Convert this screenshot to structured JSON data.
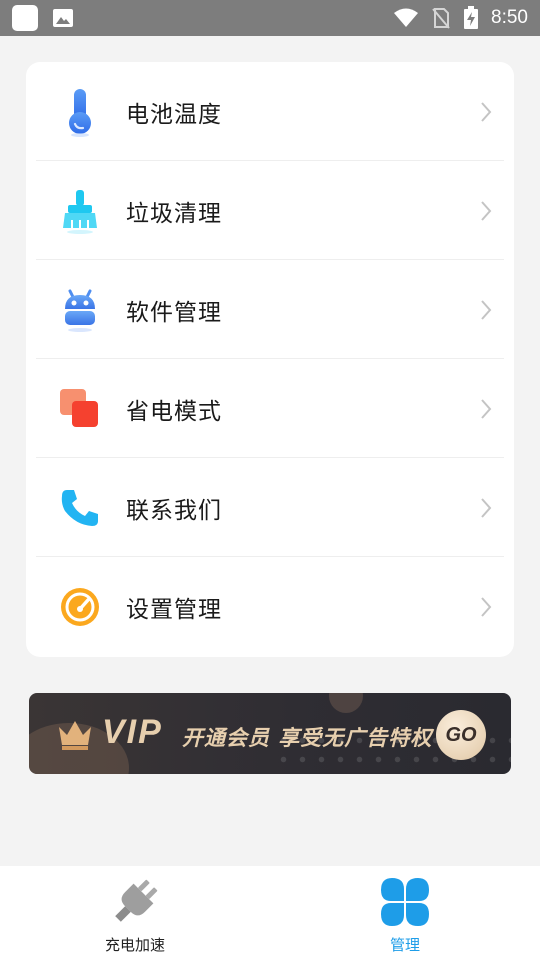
{
  "status_bar": {
    "time": "8:50",
    "icons": [
      "app-icon",
      "image-icon",
      "wifi-icon",
      "no-sim-icon",
      "battery-charging-icon"
    ]
  },
  "menu": {
    "items": [
      {
        "label": "电池温度",
        "icon": "thermometer-icon"
      },
      {
        "label": "垃圾清理",
        "icon": "broom-icon"
      },
      {
        "label": "软件管理",
        "icon": "android-robot-icon"
      },
      {
        "label": "省电模式",
        "icon": "stacked-squares-icon"
      },
      {
        "label": "联系我们",
        "icon": "phone-icon"
      },
      {
        "label": "设置管理",
        "icon": "speedometer-icon"
      }
    ]
  },
  "vip_banner": {
    "badge": "VIP",
    "slogan": "开通会员 享受无广告特权",
    "go_label": "GO"
  },
  "tabbar": {
    "tabs": [
      {
        "label": "充电加速",
        "icon": "plug-icon",
        "active": false
      },
      {
        "label": "管理",
        "icon": "four-petal-icon",
        "active": true
      }
    ]
  },
  "colors": {
    "accent": "#1e9de8",
    "vip_gold": "#e7cfae",
    "status_bar": "#7d7d7d"
  }
}
